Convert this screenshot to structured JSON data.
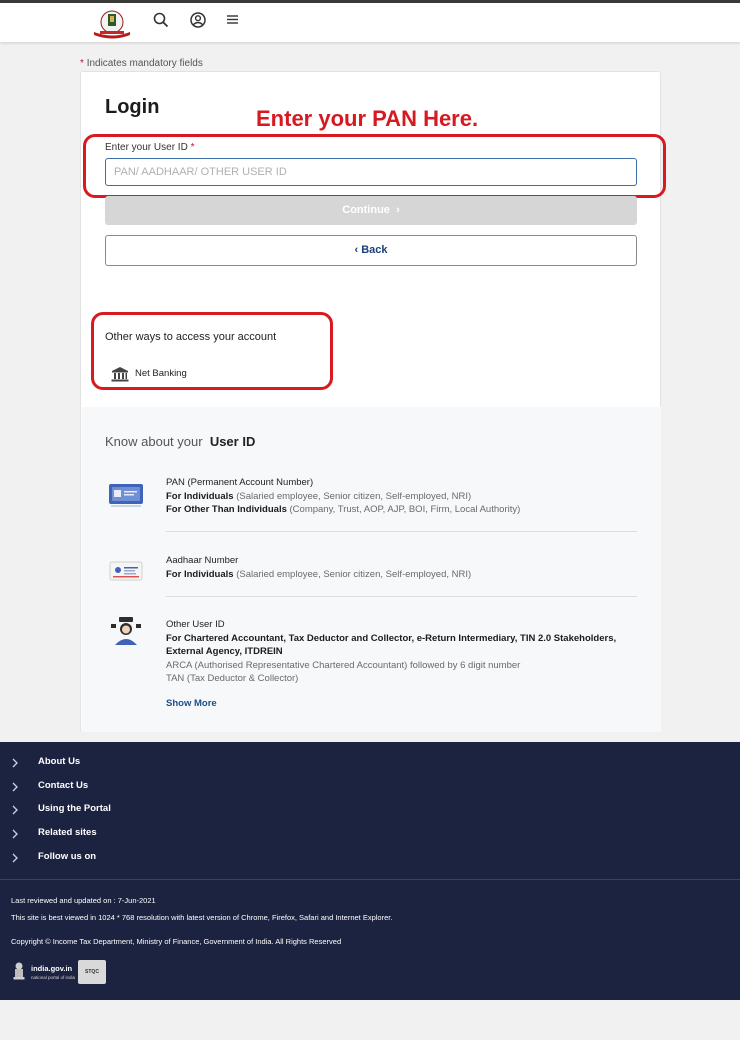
{
  "header": {
    "logo_icon": "income-tax-department-logo",
    "icons": [
      "search-icon",
      "user-circle-icon",
      "menu-icon"
    ]
  },
  "mandatory_note": {
    "star": "*",
    "text": "Indicates mandatory fields"
  },
  "login": {
    "title": "Login",
    "annotation": "Enter your PAN Here.",
    "user_id_label": "Enter your User ID",
    "required_star": "*",
    "user_id_placeholder": "PAN/ AADHAAR/ OTHER USER ID",
    "user_id_value": "",
    "continue_label": "Continue",
    "continue_chevron": "›",
    "back_chevron": "‹",
    "back_label": "Back"
  },
  "other_ways": {
    "title": "Other ways to access your account",
    "items": [
      {
        "label": "Net Banking",
        "icon": "bank-icon"
      }
    ]
  },
  "know": {
    "prefix": "Know about your",
    "bold": "User ID",
    "items": [
      {
        "icon": "pan-card-icon",
        "title": "PAN (Permanent Account Number)",
        "line1_bold": "For Individuals",
        "line1_rest": " (Salaried employee, Senior citizen, Self-employed, NRI)",
        "line2_bold": "For Other Than Individuals",
        "line2_rest": " (Company, Trust, AOP, AJP, BOI, Firm, Local Authority)"
      },
      {
        "icon": "aadhaar-card-icon",
        "title": "Aadhaar Number",
        "line1_bold": "For Individuals",
        "line1_rest": " (Salaried employee, Senior citizen, Self-employed, NRI)"
      },
      {
        "icon": "other-user-icon",
        "title": "Other User ID",
        "line1_bold": "For Chartered Accountant, Tax Deductor and Collector, e-Return Intermediary, TIN 2.0 Stakeholders, External Agency, ITDREIN",
        "line2": "ARCA (Authorised Representative Chartered Accountant) followed by 6 digit number",
        "line3": "TAN (Tax Deductor & Collector)"
      }
    ],
    "show_more": "Show More"
  },
  "footer": {
    "links": [
      "About Us",
      "Contact Us",
      "Using the Portal",
      "Related sites",
      "Follow us on"
    ],
    "last_reviewed": "Last reviewed and updated on : 7-Jun-2021",
    "best_viewed": "This site is best viewed in 1024 * 768 resolution with latest version of Chrome, Firefox, Safari and Internet Explorer.",
    "copyright": "Copyright © Income Tax Department, Ministry of Finance, Government of India. All Rights Reserved",
    "gov_logo": "india.gov.in",
    "gov_sub": "national portal of india",
    "strust_badge": "STQC",
    "emblem_icon": "national-emblem-icon"
  },
  "colors": {
    "annotation_red": "#d71920",
    "footer_bg": "#1c2340",
    "input_border": "#3a6ea5",
    "link_blue": "#1b4f8a"
  }
}
